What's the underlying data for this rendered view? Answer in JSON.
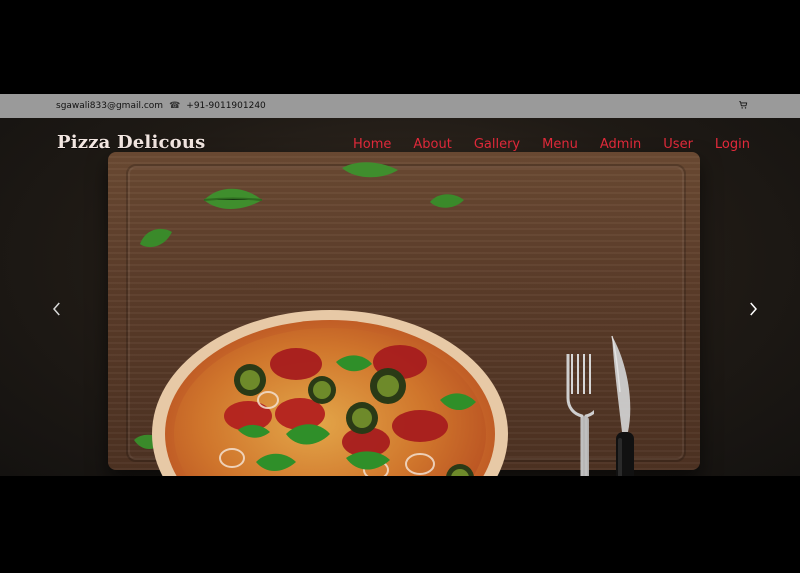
{
  "topbar": {
    "email": "sgawali833@gmail.com",
    "phone": "+91-9011901240",
    "phone_icon": "phone-icon",
    "cart_icon": "cart-icon"
  },
  "header": {
    "brand": "Pizza Delicous",
    "nav": [
      {
        "label": "Home"
      },
      {
        "label": "About"
      },
      {
        "label": "Gallery"
      },
      {
        "label": "Menu"
      },
      {
        "label": "Admin"
      },
      {
        "label": "User"
      },
      {
        "label": "Login"
      }
    ]
  },
  "hero": {
    "prev_icon": "chevron-left-icon",
    "next_icon": "chevron-right-icon"
  },
  "colors": {
    "topbar_bg": "#9a9a9a",
    "nav_link": "#e32a3b",
    "page_bg": "#000000"
  }
}
